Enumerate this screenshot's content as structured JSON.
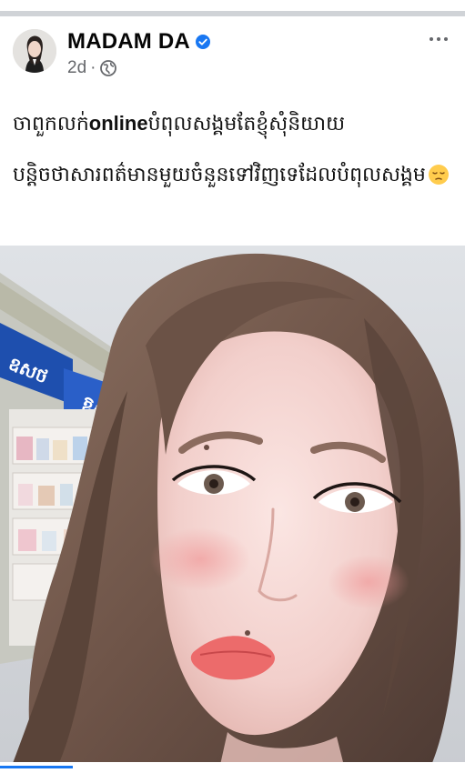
{
  "post": {
    "author": {
      "name": "MADAM DA",
      "verified": true,
      "avatar_icon": "profile-photo"
    },
    "meta": {
      "time": "2d",
      "separator": "·",
      "audience_icon": "globe-icon"
    },
    "text": {
      "part1": "ចាពួកលក់",
      "part2": "online",
      "part3": "បំពុលសង្គមតែខ្ញុំសុំនិយាយបន្តិចថាសារពត៌មានមួយចំនួនទៅវិញទេដែលបំពុលសង្គម",
      "emoji": "pensive-face-emoji"
    },
    "photo": {
      "shop_sign_text_1": "ឧសថ",
      "shop_sign_text_2": "ឱសថ"
    }
  },
  "colors": {
    "accent": "#1877f2",
    "text_primary": "#050505",
    "text_secondary": "#65676b"
  }
}
